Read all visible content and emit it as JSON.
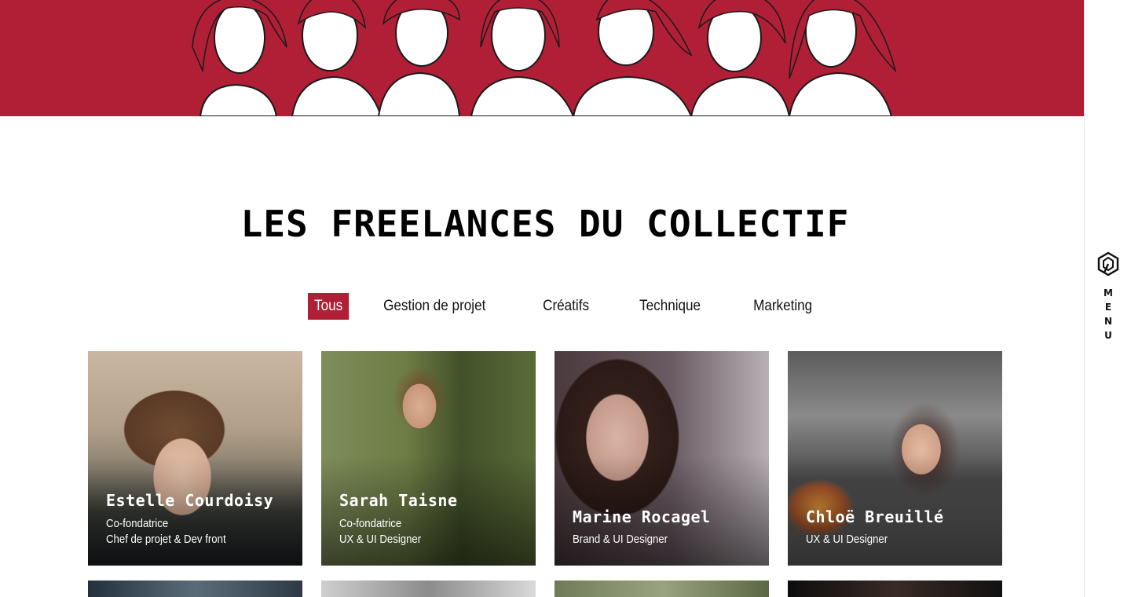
{
  "hero": {
    "illustration": "illustration of seven freelancers"
  },
  "side_menu": {
    "logo_icon": "hexagon-logo-icon",
    "label_letters": [
      "M",
      "E",
      "N",
      "U"
    ]
  },
  "page_title": "LES FREELANCES DU COLLECTIF",
  "filters": [
    {
      "label": "Tous",
      "active": true
    },
    {
      "label": "Gestion de projet",
      "active": false
    },
    {
      "label": "Créatifs",
      "active": false
    },
    {
      "label": "Technique",
      "active": false
    },
    {
      "label": "Marketing",
      "active": false
    }
  ],
  "members": [
    {
      "name": "Estelle Courdoisy",
      "role_line1": "Co-fondatrice",
      "role_line2": "Chef de projet & Dev front"
    },
    {
      "name": "Sarah Taisne",
      "role_line1": "Co-fondatrice",
      "role_line2": "UX & UI Designer"
    },
    {
      "name": "Marine Rocagel",
      "role_line1": "Brand & UI Designer"
    },
    {
      "name": "Chloë Breuillé",
      "role_line1": "UX & UI Designer"
    }
  ],
  "colors": {
    "brand_red": "#b01f35",
    "background": "#ffffff",
    "text": "#111111"
  }
}
